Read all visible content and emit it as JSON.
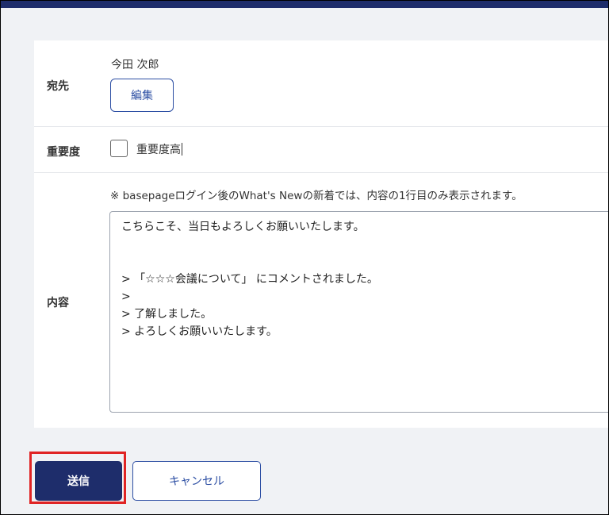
{
  "form": {
    "recipient": {
      "label": "宛先",
      "name": "今田 次郎",
      "edit_button": "編集"
    },
    "importance": {
      "label": "重要度",
      "checkbox_label": "重要度高",
      "checked": false
    },
    "content": {
      "label": "内容",
      "note": "※ basepageログイン後のWhat's Newの新着では、内容の1行目のみ表示されます。",
      "body": "こちらこそ、当日もよろしくお願いいたします。\n\n\n> 「☆☆☆会議について」 にコメントされました。\n>\n> 了解しました。\n> よろしくお願いいたします。"
    }
  },
  "actions": {
    "send_label": "送信",
    "cancel_label": "キャンセル"
  },
  "colors": {
    "navy": "#1e2d6b",
    "link_blue": "#2c4ea3",
    "highlight_red": "#e02424",
    "background": "#f0f2f5"
  }
}
